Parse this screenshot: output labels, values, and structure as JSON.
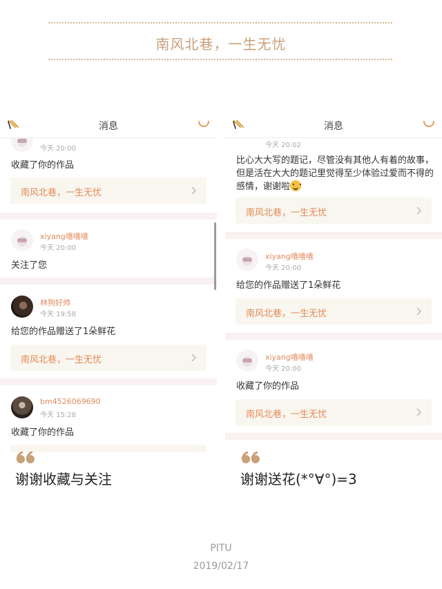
{
  "banner": {
    "title": "南风北巷，一生无忧"
  },
  "colors": {
    "accent": "#e38a59",
    "gold": "#c8a07a",
    "card_bg": "#f8f6ee",
    "separator": "#f8f0f1"
  },
  "left_panel": {
    "header_title": "消息",
    "items": [
      {
        "time": "今天 20:00",
        "message": "收藏了你的作品",
        "work": "南风北巷，一生无忧"
      },
      {
        "user": "xiyang嘻嘻嘻",
        "time": "今天 20:00",
        "message": "关注了您"
      },
      {
        "user": "林狗好帅",
        "time": "今天 19:58",
        "message": "给您的作品赠送了1朵鲜花",
        "work": "南风北巷，一生无忧"
      },
      {
        "user": "bm4526069690",
        "time": "今天 15:28",
        "message": "收藏了你的作品"
      }
    ]
  },
  "right_panel": {
    "header_title": "消息",
    "items": [
      {
        "time": "今天 20:02",
        "message": "比心大大写的题记，尽管没有其他人有着的故事，但是活在大大的题记里觉得至少体验过爱而不得的感情，谢谢啦",
        "work": "南风北巷，一生无忧"
      },
      {
        "user": "xiyang嘻嘻嘻",
        "time": "今天 20:00",
        "message": "给您的作品赠送了1朵鲜花",
        "work": "南风北巷，一生无忧"
      },
      {
        "user": "xiyang嘻嘻嘻",
        "time": "今天 20:00",
        "message": "收藏了你的作品",
        "work": "南风北巷，一生无忧"
      }
    ]
  },
  "captions": {
    "left": "谢谢收藏与关注",
    "right": "谢谢送花(*°∀°)=3"
  },
  "footer": {
    "brand": "PITU",
    "date": "2019/02/17"
  },
  "icons": [
    "back-icon",
    "search-icon",
    "chevron-right-icon",
    "quote-icon",
    "smile-emoji-icon"
  ]
}
